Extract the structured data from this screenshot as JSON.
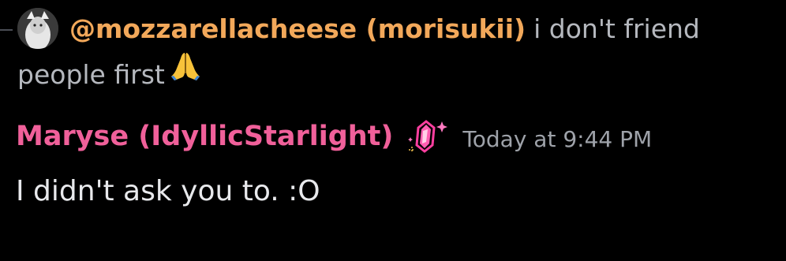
{
  "reply": {
    "author": "@mozzarellacheese (morisukii)",
    "text": "i don't friend people first",
    "emoji": "folded-hands"
  },
  "message": {
    "author": "Maryse (IdyllicStarlight)",
    "badge": "pink-crystal-badge",
    "timestamp": "Today at 9:44 PM",
    "text": "I didn't ask you to. :O"
  },
  "colors": {
    "background": "#000000",
    "reply_author": "#f2a85a",
    "message_author": "#f0609a",
    "muted_text": "#b5b8be",
    "timestamp": "#9ea2a9",
    "body_text": "#e8e9ec"
  }
}
